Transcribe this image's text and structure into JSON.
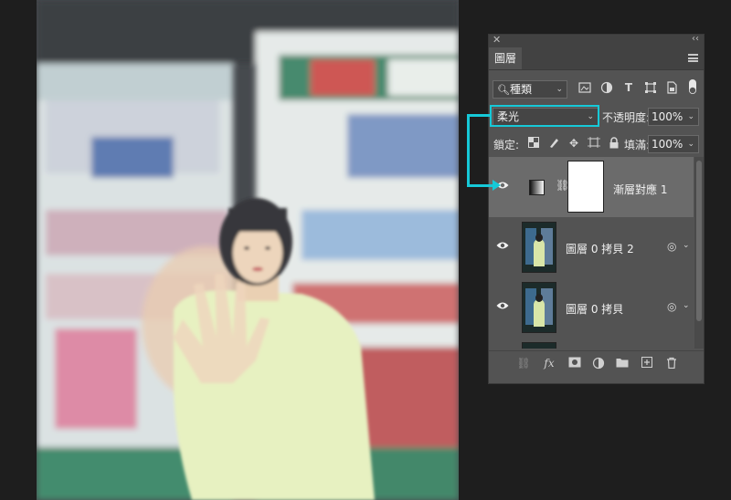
{
  "panel": {
    "tab_label": "圖層",
    "filter": {
      "kind_label": "種類"
    },
    "blend_mode": "柔光",
    "opacity_label": "不透明度:",
    "opacity_value": "100%",
    "lock_label": "鎖定:",
    "fill_label": "填滿:",
    "fill_value": "100%",
    "layers": [
      {
        "name": "漸層對應 1",
        "selected": true,
        "visible": true
      },
      {
        "name": "圖層 0 拷貝 2",
        "selected": false,
        "visible": true
      },
      {
        "name": "圖層 0 拷貝",
        "selected": false,
        "visible": true
      }
    ],
    "fx_label": "fx"
  },
  "colors": {
    "highlight": "#16c9d8",
    "panel_bg": "#535353",
    "selected_layer": "#6b6b6b"
  }
}
